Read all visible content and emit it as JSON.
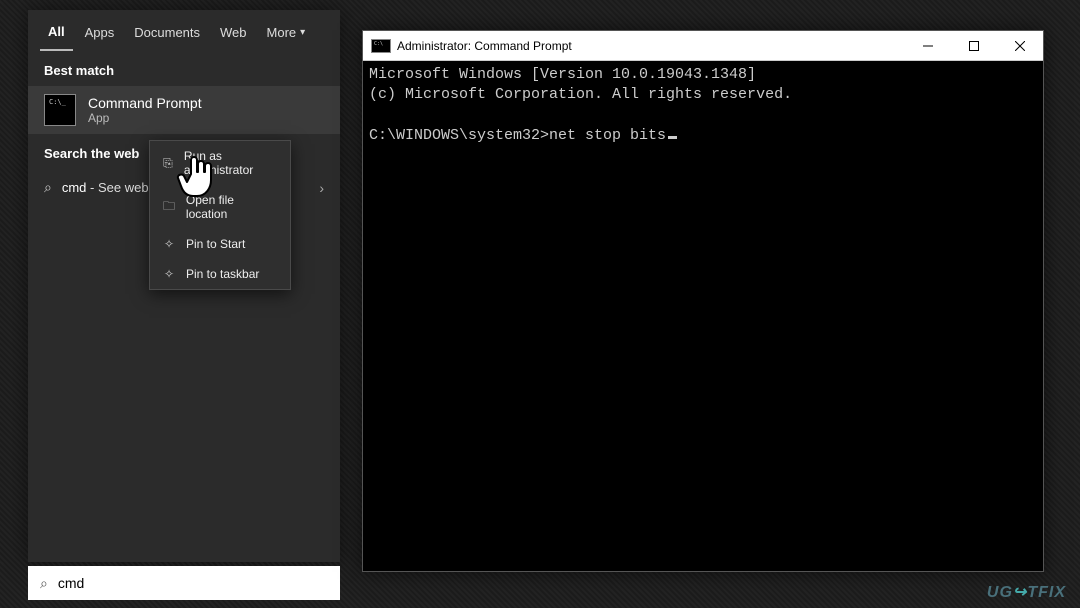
{
  "search_panel": {
    "tabs": {
      "all": "All",
      "apps": "Apps",
      "documents": "Documents",
      "web": "Web",
      "more": "More"
    },
    "section_best": "Best match",
    "best_match": {
      "title": "Command Prompt",
      "subtitle": "App"
    },
    "section_web": "Search the web",
    "web_row": {
      "term": "cmd",
      "suffix": " - See web results"
    },
    "context_menu": {
      "run_admin": "Run as administrator",
      "open_location": "Open file location",
      "pin_start": "Pin to Start",
      "pin_taskbar": "Pin to taskbar"
    }
  },
  "search_input": {
    "value": "cmd"
  },
  "cmd_window": {
    "title": "Administrator: Command Prompt",
    "line1": "Microsoft Windows [Version 10.0.19043.1348]",
    "line2": "(c) Microsoft Corporation. All rights reserved.",
    "prompt_path": "C:\\WINDOWS\\system32>",
    "command": "net stop bits"
  },
  "watermark": {
    "pre": "UG",
    "mid": "↪",
    "post": "TFIX"
  }
}
